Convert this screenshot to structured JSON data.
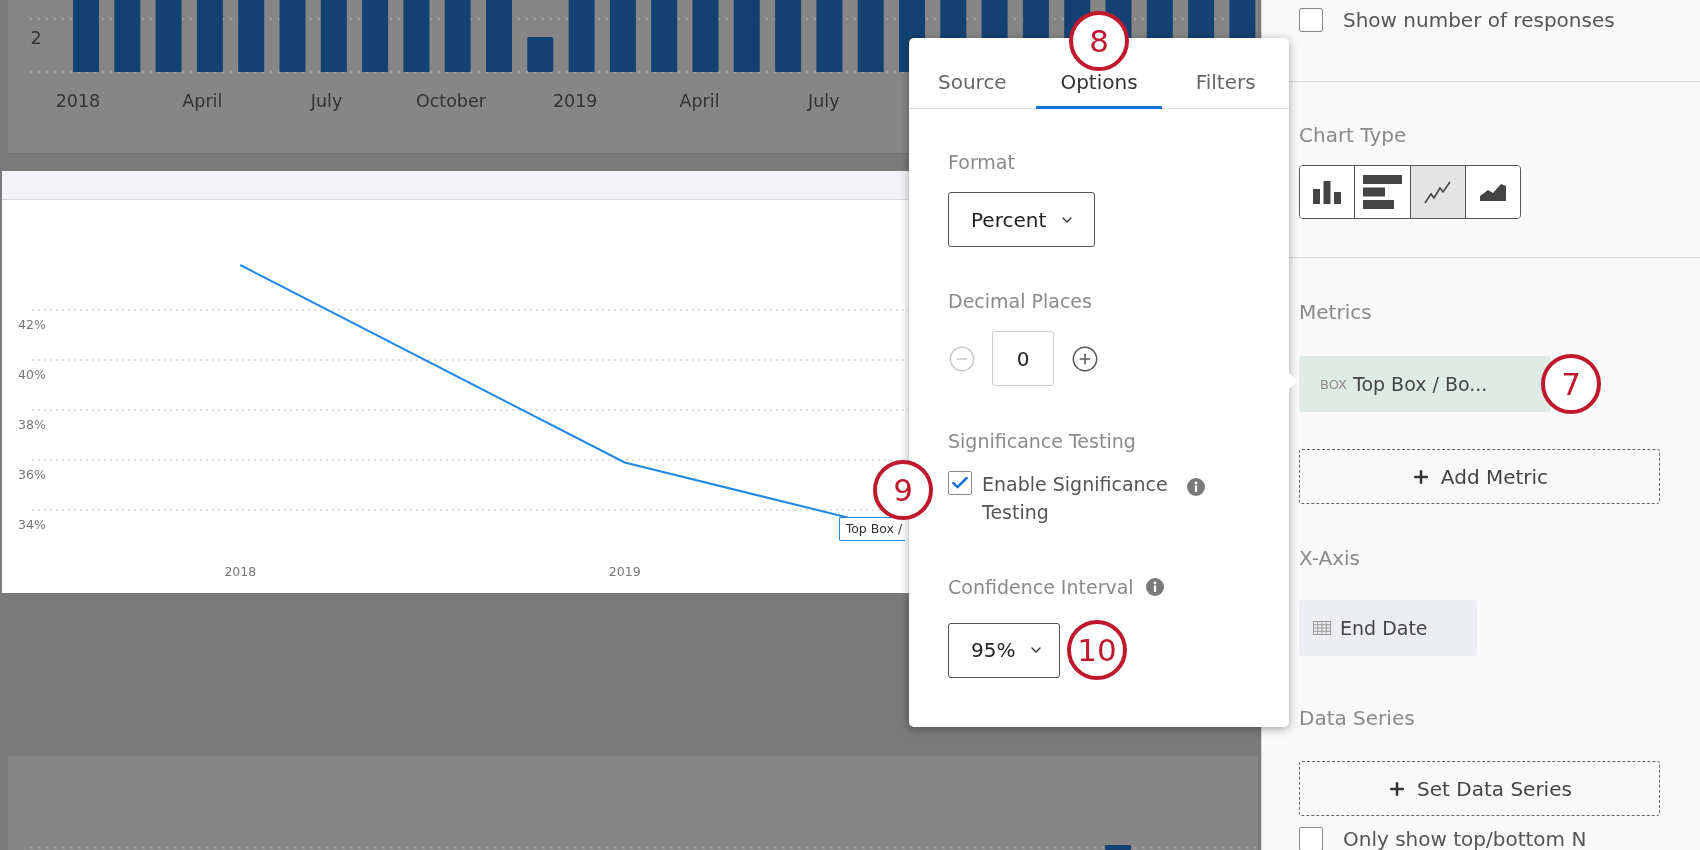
{
  "bar_chart": {
    "y_tick": "2",
    "x_labels": [
      "2018",
      "April",
      "July",
      "October",
      "2019",
      "April",
      "July"
    ]
  },
  "line_chart": {
    "data_label": "Top Box /",
    "chart_data": {
      "type": "line",
      "x": [
        2018,
        2019,
        2019.58
      ],
      "values": [
        43.8,
        35.9,
        33.7
      ],
      "xlim": [
        2017.38,
        2020.65
      ],
      "ylim": [
        30.68,
        46.4
      ],
      "grid": true,
      "xticks": [
        {
          "value": 2018,
          "label": "2018"
        },
        {
          "value": 2019,
          "label": "2019"
        }
      ],
      "yticks": [
        {
          "value": 34,
          "label": "34%"
        },
        {
          "value": 36,
          "label": "36%"
        },
        {
          "value": 38,
          "label": "38%"
        },
        {
          "value": 40,
          "label": "40%"
        },
        {
          "value": 42,
          "label": "42%"
        }
      ]
    }
  },
  "popover": {
    "tabs": [
      {
        "label": "Source",
        "selected": false
      },
      {
        "label": "Options",
        "selected": true,
        "callout": "8"
      },
      {
        "label": "Filters",
        "selected": false
      }
    ],
    "format": {
      "label": "Format",
      "value": "Percent"
    },
    "decimal_places": {
      "label": "Decimal Places",
      "value": "0",
      "decrement_disabled": true,
      "increment_disabled": false
    },
    "significance_testing": {
      "label": "Significance Testing",
      "checkbox": {
        "label": "Enable Significance Testing",
        "checked": true,
        "callout": "9"
      }
    },
    "confidence_interval": {
      "label": "Confidence Interval",
      "value": "95%",
      "callout": "10"
    }
  },
  "side_panel": {
    "show_responses": {
      "label": "Show number of responses",
      "checked": false
    },
    "chart_type": {
      "label": "Chart Type",
      "options": [
        {
          "kind": "column",
          "selected": false
        },
        {
          "kind": "bar",
          "selected": false
        },
        {
          "kind": "line",
          "selected": true
        },
        {
          "kind": "area",
          "selected": false
        }
      ]
    },
    "metrics": {
      "label": "Metrics",
      "items": [
        {
          "tag": "BOX",
          "name": "Top Box / Bo...",
          "callout": "7"
        }
      ],
      "add_label": "Add Metric"
    },
    "x_axis": {
      "label": "X-Axis",
      "value": "End Date"
    },
    "data_series": {
      "label": "Data Series",
      "add_label": "Set Data Series"
    },
    "top_bottom_n": {
      "label": "Only show top/bottom N",
      "checked": false
    }
  }
}
